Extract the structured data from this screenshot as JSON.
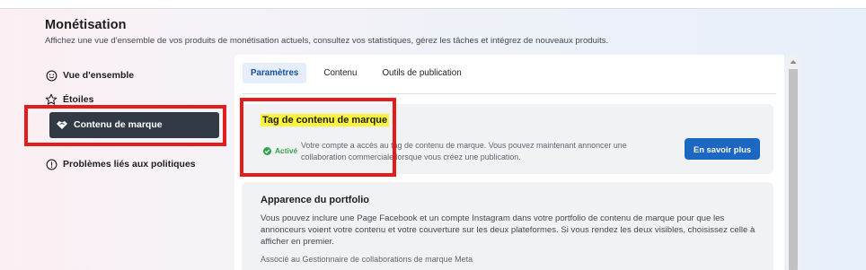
{
  "header": {
    "title": "Monétisation",
    "subtitle": "Affichez une vue d'ensemble de vos produits de monétisation actuels, consultez vos statistiques, gérez les tâches et intégrez de nouveaux produits."
  },
  "sidebar": {
    "items": [
      {
        "label": "Vue d'ensemble",
        "icon": "face-icon"
      },
      {
        "label": "Étoiles",
        "icon": "star-icon"
      },
      {
        "label": "Contenu de marque",
        "icon": "handshake-icon",
        "active": true
      },
      {
        "label": "Problèmes liés aux politiques",
        "icon": "alert-circle-icon"
      }
    ]
  },
  "tabs": [
    {
      "label": "Paramètres",
      "active": true
    },
    {
      "label": "Contenu"
    },
    {
      "label": "Outils de publication"
    }
  ],
  "branded_tag_card": {
    "title": "Tag de contenu de marque",
    "status": "Activé",
    "description": "Votre compte a accès au tag de contenu de marque. Vous pouvez maintenant annoncer une collaboration commerciale lorsque vous créez une publication.",
    "button": "En savoir plus"
  },
  "portfolio_card": {
    "title": "Apparence du portfolio",
    "description": "Vous pouvez inclure une Page Facebook et un compte Instagram dans votre portfolio de contenu de marque pour que les annonceurs voient votre contenu et votre couverture sur les deux plateformes. Si vous rendez les deux visibles, choisissez celle à afficher en premier.",
    "more": "Associé au Gestionnaire de collaborations de marque Meta"
  },
  "colors": {
    "accent": "#1b67c2",
    "active_nav": "#323a45",
    "status_green": "#31a24c",
    "highlight": "#fbf33c",
    "annotation_red": "#e31c1c"
  }
}
